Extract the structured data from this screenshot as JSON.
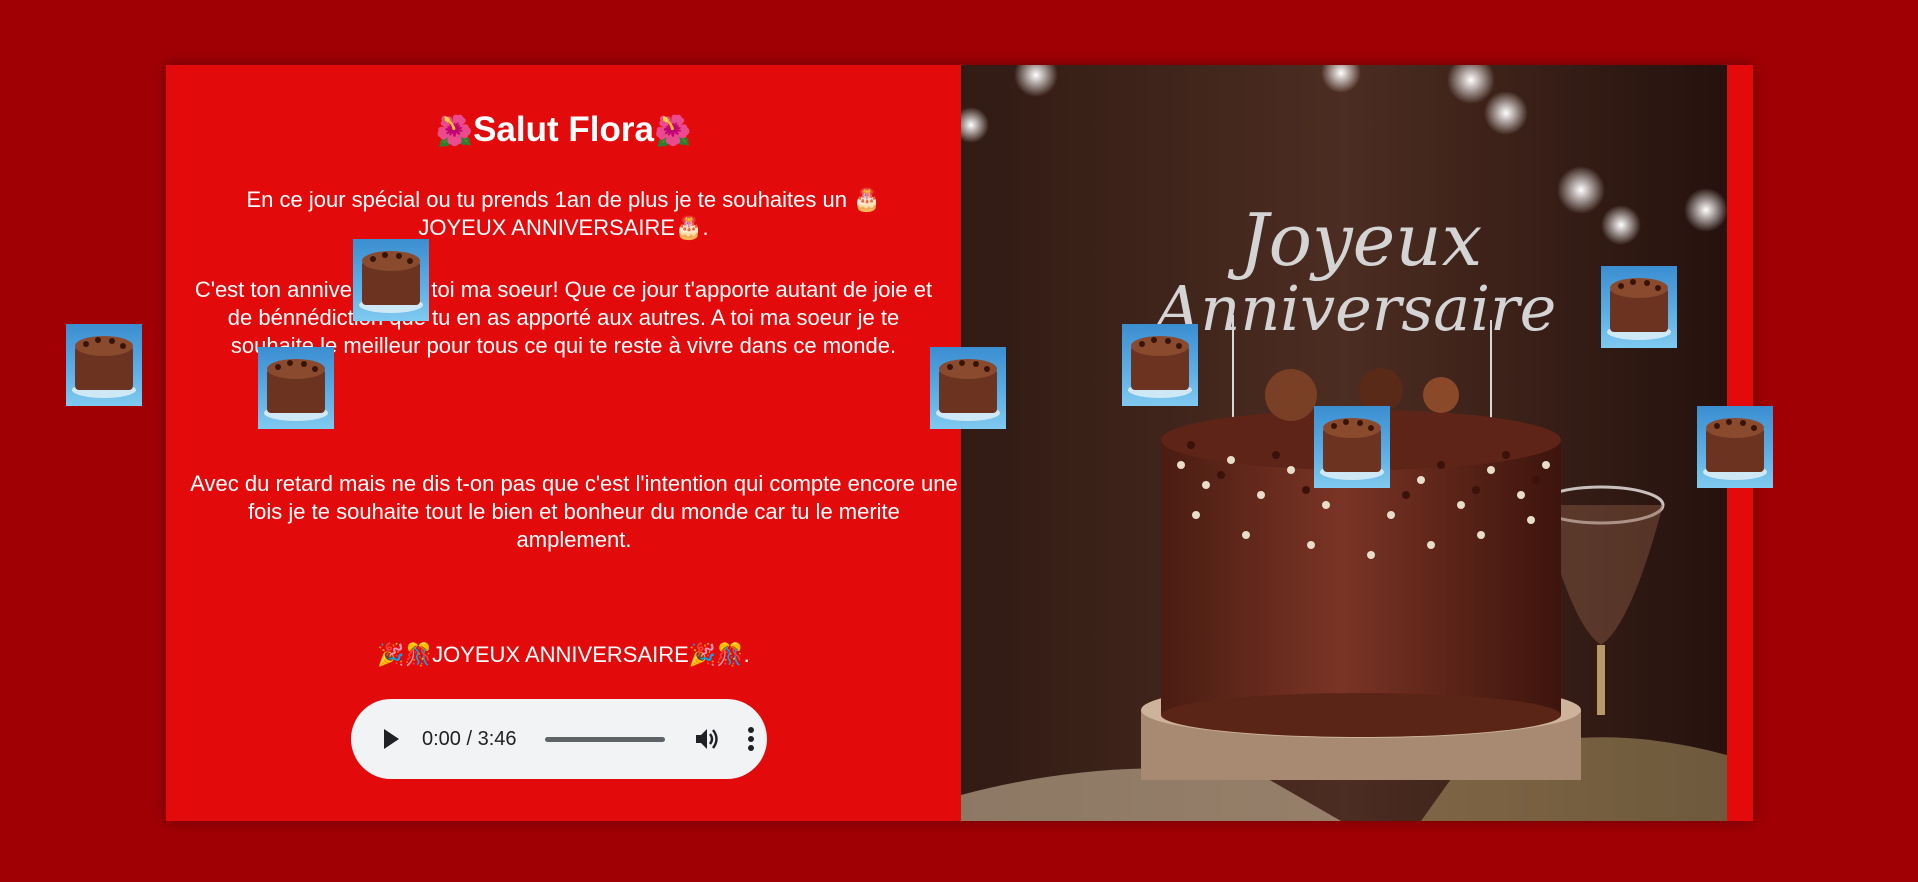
{
  "greeting": {
    "title": "Salut Flora",
    "flower_left": "🌺",
    "flower_right": "🌺"
  },
  "message": {
    "paragraph1_text": "En ce jour spécial ou tu prends 1an de plus je te souhaites un",
    "paragraph1_emoji": "🎂",
    "paragraph1_text2": "JOYEUX ANNIVERSAIRE",
    "paragraph1_emoji2": "🎂",
    "paragraph1_end": ".",
    "paragraph2": "C'est ton anniversaire,à toi ma soeur! Que ce jour t'apporte autant de joie et de bénnédiction que tu en as apporté aux autres. A toi ma soeur je te souhaite le meilleur pour tous ce qui te reste à vivre dans ce monde.",
    "paragraph3": "Avec du retard mais ne dis t-on pas que c'est l'intention qui compte encore une fois je te souhaite tout le bien et bonheur du monde car tu le merite amplement.",
    "closing_emoji_start": "🎉🎊",
    "closing_text": "JOYEUX ANNIVERSAIRE",
    "closing_emoji_end": "🎉🎊",
    "closing_end": "."
  },
  "audio_player": {
    "time_display": "0:00 / 3:46",
    "progress": 0,
    "play_icon": "play-icon",
    "volume_icon": "volume-icon",
    "more_icon": "more-options-icon"
  },
  "photo": {
    "topper_line1": "Joyeux",
    "topper_line2": "Anniversaire"
  },
  "colors": {
    "background": "#a00004",
    "card": "#e30a0b",
    "text": "#ffffff"
  }
}
